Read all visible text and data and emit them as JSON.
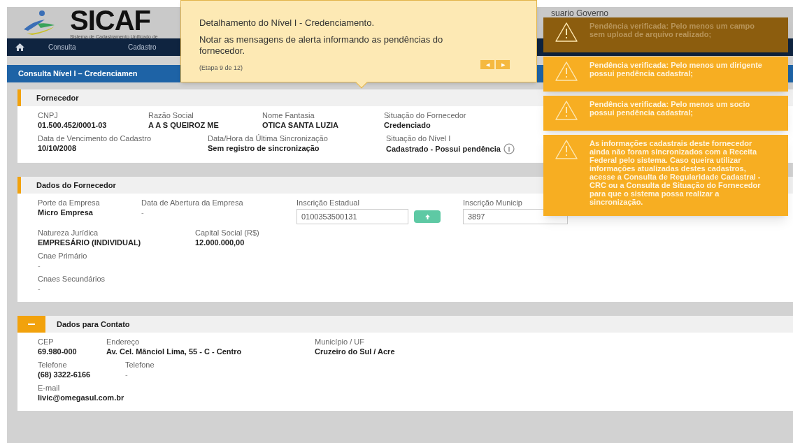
{
  "header": {
    "logo_text": "SICAF",
    "logo_subtitle": "Sistema de Cadastramento Unificado de",
    "user": "suario Governo"
  },
  "nav": {
    "items": [
      "Consulta",
      "Cadastro"
    ]
  },
  "breadcrumb": "Consulta Nível I – Credenciamen",
  "tour": {
    "title": "Detalhamento do Nível I - Credenciamento.",
    "body": "Notar as mensagens de alerta informando as pendências do fornecedor.",
    "step": "(Etapa 9 de 12)",
    "prev": "◀",
    "next": "▶"
  },
  "alerts": [
    {
      "text": "Pendência verificada: Pelo menos um campo sem upload de arquivo realizado;",
      "dimmed": true
    },
    {
      "text": "Pendência verificada: Pelo menos um dirigente possui pendência cadastral;",
      "dimmed": false
    },
    {
      "text": "Pendência verificada: Pelo menos um socio possui pendência cadastral;",
      "dimmed": false
    },
    {
      "text": "As informações cadastrais deste fornecedor ainda não foram sincronizados com a Receita Federal pelo sistema. Caso queira utilizar informações atualizadas destes cadastros, acesse a Consulta de Regularidade Cadastral - CRC ou a Consulta de Situação do Fornecedor para que o sistema possa realizar a sincronização.",
      "dimmed": false
    }
  ],
  "sections": [
    {
      "title": "Fornecedor",
      "collapsible": false,
      "lines": [
        [
          {
            "label": "CNPJ",
            "value": "01.500.452/0001-03",
            "kind": "text"
          },
          {
            "label": "Razão Social",
            "value": "A A S QUEIROZ ME",
            "kind": "text"
          },
          {
            "label": "Nome Fantasia",
            "value": "OTICA SANTA LUZIA",
            "kind": "text"
          },
          {
            "label": "Situação do Fornecedor",
            "value": "Credenciado",
            "kind": "text"
          }
        ],
        [
          {
            "label": "Data de Vencimento do Cadastro",
            "value": "10/10/2008",
            "kind": "text"
          },
          {
            "label": "Data/Hora da Última Sincronização",
            "value": "Sem registro de sincronização",
            "kind": "text"
          },
          {
            "label": "Situação do Nível I",
            "value": "Cadastrado - Possui pendência",
            "kind": "info"
          }
        ]
      ]
    },
    {
      "title": "Dados do Fornecedor",
      "collapsible": false,
      "lines": [
        [
          {
            "label": "Porte da Empresa",
            "value": "Micro Empresa",
            "kind": "text"
          },
          {
            "label": "Data de Abertura da Empresa",
            "value": "-",
            "kind": "plain"
          },
          {
            "label": "Inscrição Estadual",
            "value": "0100353500131",
            "kind": "upload"
          },
          {
            "label": "Inscrição Municip",
            "value": "3897",
            "kind": "field"
          }
        ],
        [
          {
            "label": "Natureza Jurídica",
            "value": "EMPRESÁRIO (INDIVIDUAL)",
            "kind": "text"
          },
          {
            "label": "Capital Social (R$)",
            "value": "12.000.000,00",
            "kind": "text"
          }
        ],
        [
          {
            "label": "Cnae Primário",
            "value": "-",
            "kind": "plain"
          }
        ],
        [
          {
            "label": "Cnaes Secundários",
            "value": "-",
            "kind": "plain"
          }
        ]
      ]
    },
    {
      "title": "Dados para Contato",
      "collapsible": true,
      "lines": [
        [
          {
            "label": "CEP",
            "value": "69.980-000",
            "kind": "text"
          },
          {
            "label": "Endereço",
            "value": "Av. Cel. Mânciol Lima, 55 - C - Centro",
            "kind": "text"
          },
          {
            "label": "Município / UF",
            "value": "Cruzeiro do Sul / Acre",
            "kind": "text"
          }
        ],
        [
          {
            "label": "Telefone",
            "value": "(68) 3322-6166",
            "kind": "text"
          },
          {
            "label": "Telefone",
            "value": "-",
            "kind": "plain"
          }
        ],
        [
          {
            "label": "E-mail",
            "value": "livic@omegasul.com.br",
            "kind": "text"
          }
        ]
      ]
    }
  ]
}
